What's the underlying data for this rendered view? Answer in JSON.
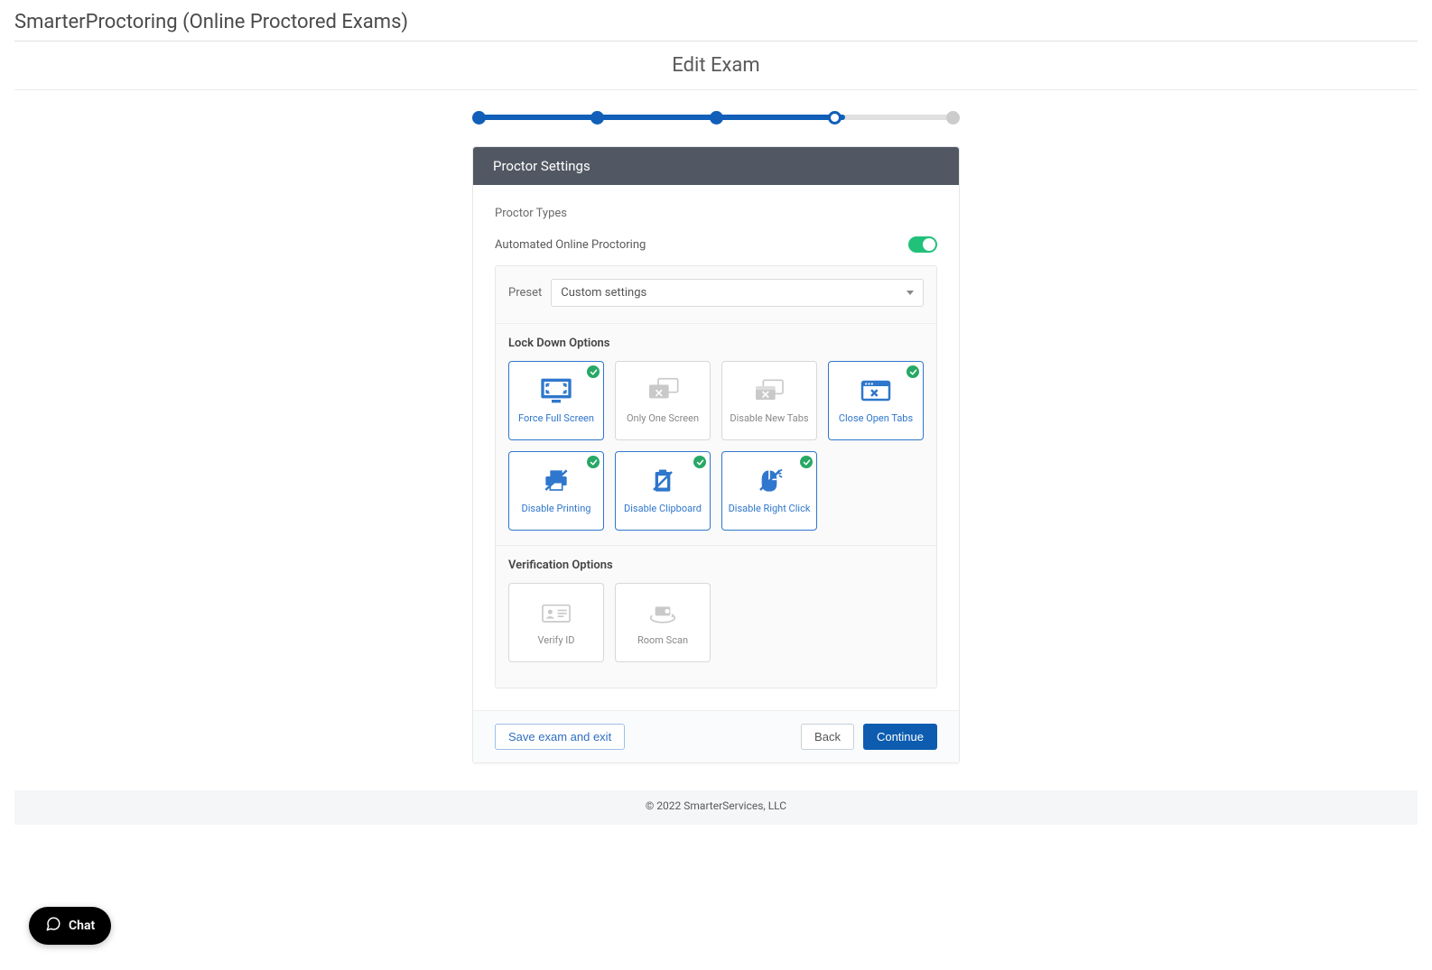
{
  "app_title": "SmarterProctoring (Online Proctored Exams)",
  "page_title": "Edit Exam",
  "stepper": {
    "total": 5,
    "current_index": 3
  },
  "card": {
    "header": "Proctor Settings",
    "section_label": "Proctor Types",
    "automated_toggle": {
      "label": "Automated Online Proctoring",
      "on": true
    },
    "preset": {
      "label": "Preset",
      "value": "Custom settings"
    },
    "lockdown_heading": "Lock Down Options",
    "lockdown_options": [
      {
        "name": "force-full-screen",
        "label": "Force Full Screen",
        "selected": true
      },
      {
        "name": "only-one-screen",
        "label": "Only One Screen",
        "selected": false
      },
      {
        "name": "disable-new-tabs",
        "label": "Disable New Tabs",
        "selected": false
      },
      {
        "name": "close-open-tabs",
        "label": "Close Open Tabs",
        "selected": true
      },
      {
        "name": "disable-printing",
        "label": "Disable Printing",
        "selected": true
      },
      {
        "name": "disable-clipboard",
        "label": "Disable Clipboard",
        "selected": true
      },
      {
        "name": "disable-right-click",
        "label": "Disable Right Click",
        "selected": true
      }
    ],
    "verification_heading": "Verification Options",
    "verification_options": [
      {
        "name": "verify-id",
        "label": "Verify ID",
        "selected": false
      },
      {
        "name": "room-scan",
        "label": "Room Scan",
        "selected": false
      }
    ]
  },
  "footer_buttons": {
    "save_exit": "Save exam and exit",
    "back": "Back",
    "continue": "Continue"
  },
  "chat": {
    "label": "Chat"
  },
  "page_footer": "© 2022 SmarterServices, LLC",
  "colors": {
    "primary": "#115fb8",
    "accent_green": "#21c17a",
    "header_bg": "#515863"
  }
}
